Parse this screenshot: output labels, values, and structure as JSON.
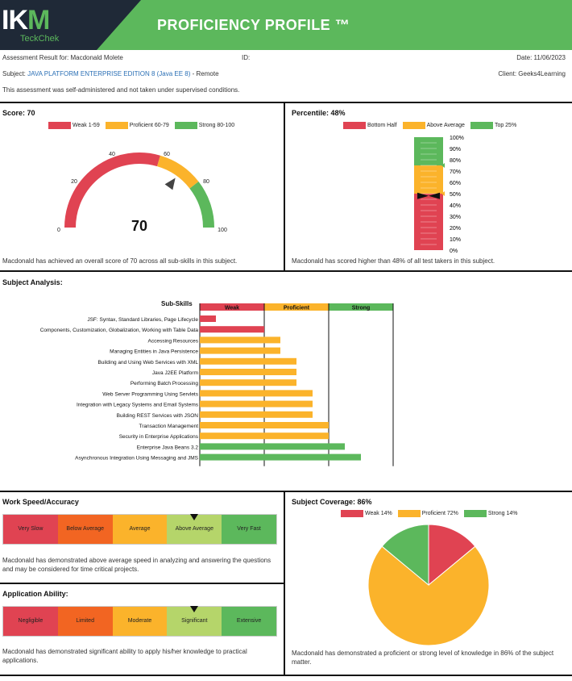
{
  "header": {
    "logo_main": "IKM",
    "logo_sub": "TeckChek",
    "title": "PROFICIENCY PROFILE ™"
  },
  "info": {
    "result_for": "Assessment Result for: Macdonald Molete",
    "id_label": "ID:",
    "date": "Date: 11/06/2023",
    "subject_label": "Subject:",
    "subject_name": "JAVA PLATFORM ENTERPRISE EDITION 8 (Java EE 8)",
    "subject_suffix": "- Remote",
    "client": "Client: Geeks4Learning",
    "note": "This assessment was self-administered and not taken under supervised conditions."
  },
  "score": {
    "title": "Score: 70",
    "value": "70",
    "legend": [
      {
        "label": "Weak 1-59",
        "color": "#e04352"
      },
      {
        "label": "Proficient 60-79",
        "color": "#fbb32b"
      },
      {
        "label": "Strong 80-100",
        "color": "#5cb85c"
      }
    ],
    "ticks": [
      "0",
      "20",
      "40",
      "60",
      "80",
      "100"
    ],
    "note": "Macdonald has achieved an overall score of 70 across all sub-skills in this subject."
  },
  "percentile": {
    "title": "Percentile: 48%",
    "value": 48,
    "legend": [
      {
        "label": "Bottom Half",
        "color": "#e04352"
      },
      {
        "label": "Above Average",
        "color": "#fbb32b"
      },
      {
        "label": "Top 25%",
        "color": "#5cb85c"
      }
    ],
    "ticks": [
      "100%",
      "90%",
      "80%",
      "70%",
      "60%",
      "50%",
      "40%",
      "30%",
      "20%",
      "10%",
      "0%"
    ],
    "note": "Macdonald has scored higher than 48% of all test takers in this subject."
  },
  "subject_analysis": {
    "title": "Subject Analysis:",
    "header_label": "Sub-Skills",
    "bands": [
      {
        "label": "Weak",
        "color": "#e04352"
      },
      {
        "label": "Proficient",
        "color": "#fbb32b"
      },
      {
        "label": "Strong",
        "color": "#5cb85c"
      }
    ]
  },
  "chart_data": {
    "type": "bar",
    "categories": [
      "JSF: Syntax, Standard Libraries, Page Lifecycle",
      "Components, Customization, Globalization, Working with Table Data",
      "Accessing Resources",
      "Managing Entities in Java Persistence",
      "Building and Using Web Services with XML",
      "Java J2EE Platform",
      "Performing Batch Processing",
      "Web Server Programming Using Servlets",
      "Integration with Legacy Systems and Email Systems",
      "Building REST Services with JSON",
      "Transaction Management",
      "Security in Enterprise Applications",
      "Enterprise Java Beans 3.2",
      "Asynchronous Integration Using Messaging and JMS"
    ],
    "values": [
      5,
      20,
      25,
      25,
      30,
      30,
      30,
      35,
      35,
      35,
      40,
      40,
      45,
      50
    ],
    "levels": [
      "weak",
      "weak",
      "proficient",
      "proficient",
      "proficient",
      "proficient",
      "proficient",
      "proficient",
      "proficient",
      "proficient",
      "proficient",
      "proficient",
      "strong",
      "strong"
    ],
    "xlim": [
      0,
      60
    ]
  },
  "work_speed": {
    "title": "Work Speed/Accuracy",
    "cells": [
      {
        "label": "Very Slow",
        "color": "#e04352"
      },
      {
        "label": "Below Average",
        "color": "#f26522"
      },
      {
        "label": "Average",
        "color": "#fbb32b"
      },
      {
        "label": "Above Average",
        "color": "#b5d56a"
      },
      {
        "label": "Very Fast",
        "color": "#5cb85c"
      }
    ],
    "selected_index": 3,
    "note": "Macdonald has demonstrated above average speed in analyzing and answering the questions and may be considered for time critical projects."
  },
  "application": {
    "title": "Application Ability:",
    "cells": [
      {
        "label": "Negligible",
        "color": "#e04352"
      },
      {
        "label": "Limited",
        "color": "#f26522"
      },
      {
        "label": "Moderate",
        "color": "#fbb32b"
      },
      {
        "label": "Significant",
        "color": "#b5d56a"
      },
      {
        "label": "Extensive",
        "color": "#5cb85c"
      }
    ],
    "selected_index": 3,
    "note": "Macdonald has demonstrated significant ability to apply his/her knowledge to practical applications."
  },
  "coverage": {
    "title": "Subject Coverage: 86%",
    "slices": [
      {
        "label": "Weak 14%",
        "value": 14,
        "color": "#e04352"
      },
      {
        "label": "Proficient 72%",
        "value": 72,
        "color": "#fbb32b"
      },
      {
        "label": "Strong 14%",
        "value": 14,
        "color": "#5cb85c"
      }
    ],
    "note": "Macdonald has demonstrated a proficient or strong level of knowledge in 86% of the subject matter."
  }
}
